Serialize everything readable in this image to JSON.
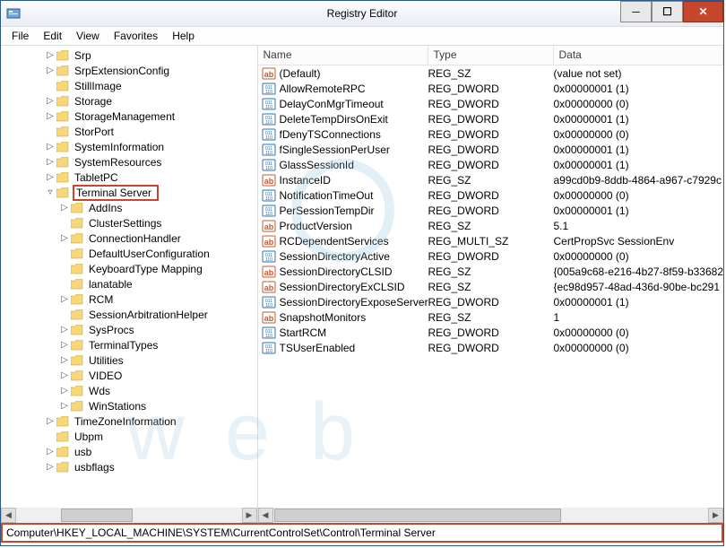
{
  "window": {
    "title": "Registry Editor"
  },
  "menubar": {
    "items": [
      "File",
      "Edit",
      "View",
      "Favorites",
      "Help"
    ]
  },
  "winbuttons": {
    "min": "─",
    "max": "☐",
    "close": "✕"
  },
  "tree": {
    "items": [
      {
        "indent": 3,
        "exp": "▷",
        "label": "Srp"
      },
      {
        "indent": 3,
        "exp": "▷",
        "label": "SrpExtensionConfig"
      },
      {
        "indent": 3,
        "exp": "",
        "label": "StillImage"
      },
      {
        "indent": 3,
        "exp": "▷",
        "label": "Storage"
      },
      {
        "indent": 3,
        "exp": "▷",
        "label": "StorageManagement"
      },
      {
        "indent": 3,
        "exp": "",
        "label": "StorPort"
      },
      {
        "indent": 3,
        "exp": "▷",
        "label": "SystemInformation"
      },
      {
        "indent": 3,
        "exp": "▷",
        "label": "SystemResources"
      },
      {
        "indent": 3,
        "exp": "▷",
        "label": "TabletPC"
      },
      {
        "indent": 3,
        "exp": "▿",
        "label": "Terminal Server",
        "selected": true
      },
      {
        "indent": 4,
        "exp": "▷",
        "label": "AddIns"
      },
      {
        "indent": 4,
        "exp": "",
        "label": "ClusterSettings"
      },
      {
        "indent": 4,
        "exp": "▷",
        "label": "ConnectionHandler"
      },
      {
        "indent": 4,
        "exp": "",
        "label": "DefaultUserConfiguration"
      },
      {
        "indent": 4,
        "exp": "",
        "label": "KeyboardType Mapping"
      },
      {
        "indent": 4,
        "exp": "",
        "label": "lanatable"
      },
      {
        "indent": 4,
        "exp": "▷",
        "label": "RCM"
      },
      {
        "indent": 4,
        "exp": "",
        "label": "SessionArbitrationHelper"
      },
      {
        "indent": 4,
        "exp": "▷",
        "label": "SysProcs"
      },
      {
        "indent": 4,
        "exp": "▷",
        "label": "TerminalTypes"
      },
      {
        "indent": 4,
        "exp": "▷",
        "label": "Utilities"
      },
      {
        "indent": 4,
        "exp": "▷",
        "label": "VIDEO"
      },
      {
        "indent": 4,
        "exp": "▷",
        "label": "Wds"
      },
      {
        "indent": 4,
        "exp": "▷",
        "label": "WinStations"
      },
      {
        "indent": 3,
        "exp": "▷",
        "label": "TimeZoneInformation"
      },
      {
        "indent": 3,
        "exp": "",
        "label": "Ubpm"
      },
      {
        "indent": 3,
        "exp": "▷",
        "label": "usb"
      },
      {
        "indent": 3,
        "exp": "▷",
        "label": "usbflags"
      }
    ]
  },
  "list": {
    "headers": {
      "name": "Name",
      "type": "Type",
      "data": "Data"
    },
    "rows": [
      {
        "icon": "sz",
        "name": "(Default)",
        "type": "REG_SZ",
        "data": "(value not set)"
      },
      {
        "icon": "dw",
        "name": "AllowRemoteRPC",
        "type": "REG_DWORD",
        "data": "0x00000001 (1)"
      },
      {
        "icon": "dw",
        "name": "DelayConMgrTimeout",
        "type": "REG_DWORD",
        "data": "0x00000000 (0)"
      },
      {
        "icon": "dw",
        "name": "DeleteTempDirsOnExit",
        "type": "REG_DWORD",
        "data": "0x00000001 (1)"
      },
      {
        "icon": "dw",
        "name": "fDenyTSConnections",
        "type": "REG_DWORD",
        "data": "0x00000000 (0)"
      },
      {
        "icon": "dw",
        "name": "fSingleSessionPerUser",
        "type": "REG_DWORD",
        "data": "0x00000001 (1)"
      },
      {
        "icon": "dw",
        "name": "GlassSessionId",
        "type": "REG_DWORD",
        "data": "0x00000001 (1)"
      },
      {
        "icon": "sz",
        "name": "InstanceID",
        "type": "REG_SZ",
        "data": "a99cd0b9-8ddb-4864-a967-c7929c"
      },
      {
        "icon": "dw",
        "name": "NotificationTimeOut",
        "type": "REG_DWORD",
        "data": "0x00000000 (0)"
      },
      {
        "icon": "dw",
        "name": "PerSessionTempDir",
        "type": "REG_DWORD",
        "data": "0x00000001 (1)"
      },
      {
        "icon": "sz",
        "name": "ProductVersion",
        "type": "REG_SZ",
        "data": "5.1"
      },
      {
        "icon": "sz",
        "name": "RCDependentServices",
        "type": "REG_MULTI_SZ",
        "data": "CertPropSvc SessionEnv"
      },
      {
        "icon": "dw",
        "name": "SessionDirectoryActive",
        "type": "REG_DWORD",
        "data": "0x00000000 (0)"
      },
      {
        "icon": "sz",
        "name": "SessionDirectoryCLSID",
        "type": "REG_SZ",
        "data": "{005a9c68-e216-4b27-8f59-b33682"
      },
      {
        "icon": "sz",
        "name": "SessionDirectoryExCLSID",
        "type": "REG_SZ",
        "data": "{ec98d957-48ad-436d-90be-bc291"
      },
      {
        "icon": "dw",
        "name": "SessionDirectoryExposeServerIP",
        "type": "REG_DWORD",
        "data": "0x00000001 (1)"
      },
      {
        "icon": "sz",
        "name": "SnapshotMonitors",
        "type": "REG_SZ",
        "data": "1"
      },
      {
        "icon": "dw",
        "name": "StartRCM",
        "type": "REG_DWORD",
        "data": "0x00000000 (0)"
      },
      {
        "icon": "dw",
        "name": "TSUserEnabled",
        "type": "REG_DWORD",
        "data": "0x00000000 (0)"
      }
    ]
  },
  "scroll": {
    "left_glyph": "◀",
    "right_glyph": "▶"
  },
  "statusbar": {
    "path": "Computer\\HKEY_LOCAL_MACHINE\\SYSTEM\\CurrentControlSet\\Control\\Terminal Server"
  }
}
